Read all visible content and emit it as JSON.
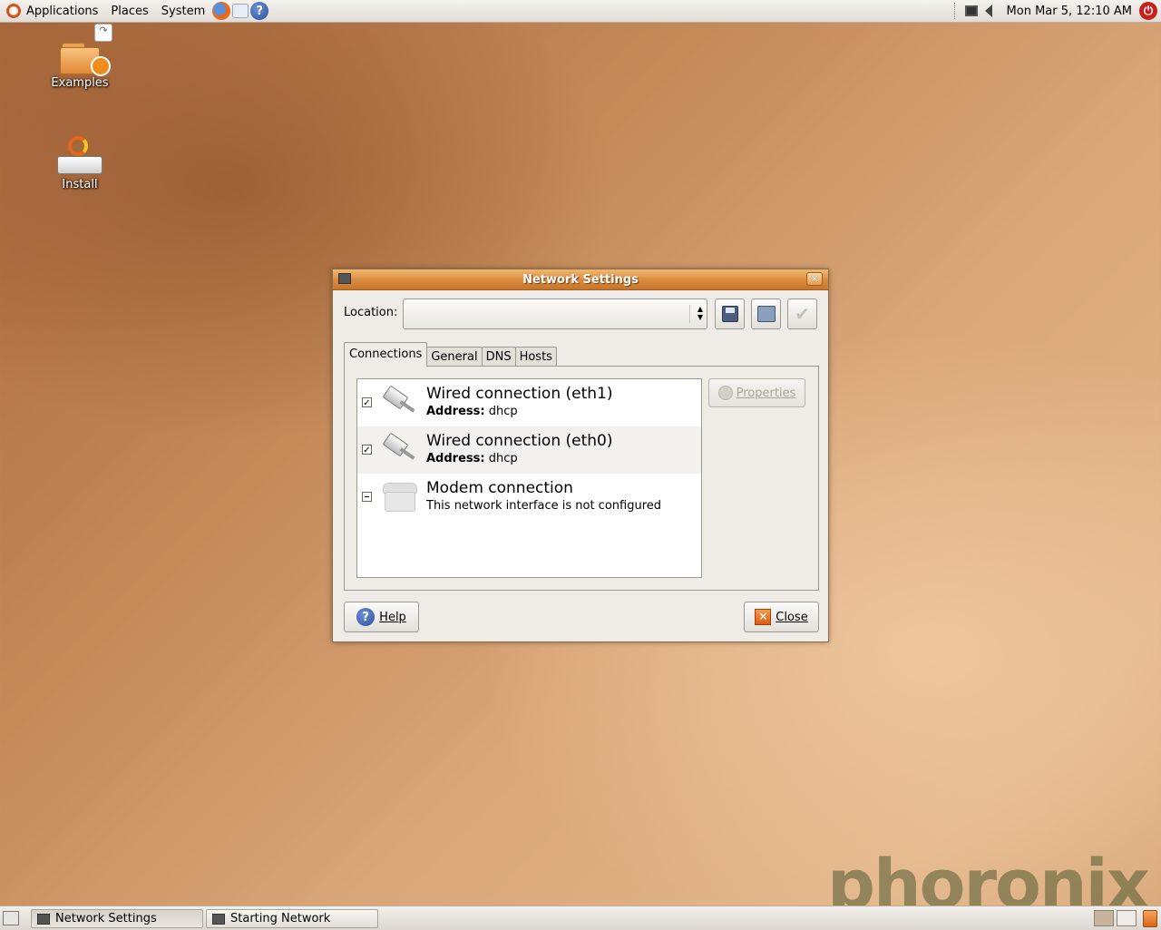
{
  "top_panel": {
    "menus": [
      "Applications",
      "Places",
      "System"
    ],
    "launchers": [
      "firefox-icon",
      "mail-icon",
      "help-icon"
    ],
    "help_glyph": "?",
    "clock": "Mon Mar  5, 12:10 AM",
    "power_glyph": "⏻"
  },
  "desktop": {
    "icons": [
      {
        "label": "Examples",
        "icon": "folder-icon"
      },
      {
        "label": "Install",
        "icon": "install-icon"
      }
    ],
    "link_glyph": "↷"
  },
  "dialog": {
    "title": "Network Settings",
    "close_glyph": "✕",
    "location_label": "Location:",
    "location_value": "",
    "arrow_up": "▲",
    "arrow_down": "▼",
    "apply_glyph": "✔",
    "tabs": [
      "Connections",
      "General",
      "DNS",
      "Hosts"
    ],
    "active_tab": "Connections",
    "connections": [
      {
        "title": "Wired connection (eth1)",
        "address_label": "Address:",
        "address": "dhcp",
        "enabled": true
      },
      {
        "title": "Wired connection (eth0)",
        "address_label": "Address:",
        "address": "dhcp",
        "enabled": true
      },
      {
        "title": "Modem connection",
        "subtitle": "This network interface is not configured",
        "enabled": "inconsistent"
      }
    ],
    "properties_label": "Properties",
    "help_label": "Help",
    "help_glyph": "?",
    "close_label": "Close"
  },
  "watermark": "phoronix",
  "bottom_panel": {
    "tasks": [
      "Network Settings",
      "Starting Network"
    ]
  },
  "colors": {
    "titlebar": "#d88a3c",
    "desktop": "#c48a58",
    "accent": "#dd5a12"
  }
}
